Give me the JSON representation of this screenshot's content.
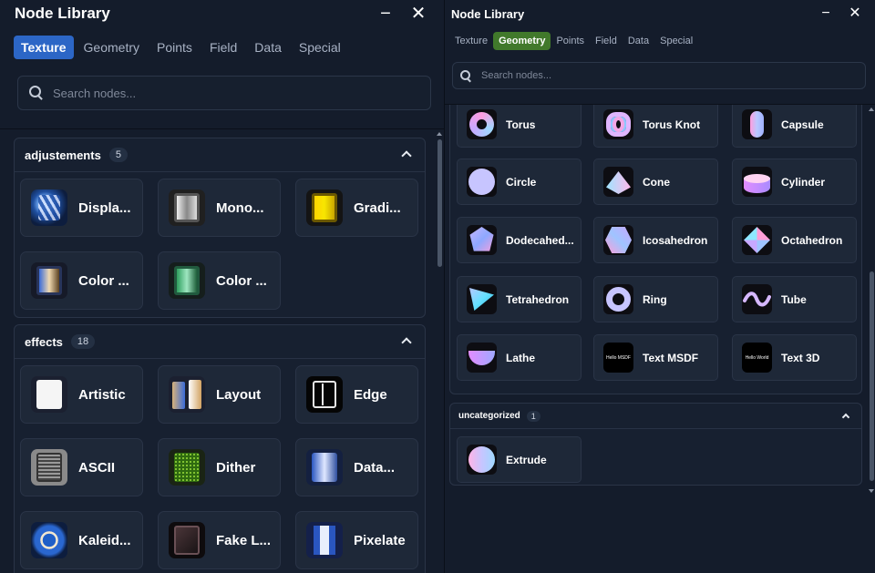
{
  "left": {
    "title": "Node Library",
    "minimize": "−",
    "close": "✕",
    "tabs": [
      "Texture",
      "Geometry",
      "Points",
      "Field",
      "Data",
      "Special"
    ],
    "search_placeholder": "Search nodes...",
    "sections": [
      {
        "title": "adjustements",
        "count": "5",
        "items": [
          {
            "label": "Displa..."
          },
          {
            "label": "Mono..."
          },
          {
            "label": "Gradi..."
          },
          {
            "label": "Color ..."
          },
          {
            "label": "Color ..."
          }
        ]
      },
      {
        "title": "effects",
        "count": "18",
        "items": [
          {
            "label": "Artistic"
          },
          {
            "label": "Layout"
          },
          {
            "label": "Edge"
          },
          {
            "label": "ASCII"
          },
          {
            "label": "Dither"
          },
          {
            "label": "Data..."
          },
          {
            "label": "Kaleid..."
          },
          {
            "label": "Fake L..."
          },
          {
            "label": "Pixelate"
          }
        ]
      }
    ]
  },
  "right": {
    "title": "Node Library",
    "minimize": "−",
    "close": "✕",
    "tabs": [
      "Texture",
      "Geometry",
      "Points",
      "Field",
      "Data",
      "Special"
    ],
    "search_placeholder": "Search nodes...",
    "items": [
      {
        "label": "Torus"
      },
      {
        "label": "Torus Knot"
      },
      {
        "label": "Capsule"
      },
      {
        "label": "Circle"
      },
      {
        "label": "Cone"
      },
      {
        "label": "Cylinder"
      },
      {
        "label": "Dodecahed..."
      },
      {
        "label": "Icosahedron"
      },
      {
        "label": "Octahedron"
      },
      {
        "label": "Tetrahedron"
      },
      {
        "label": "Ring"
      },
      {
        "label": "Tube"
      },
      {
        "label": "Lathe"
      },
      {
        "label": "Text MSDF",
        "thumb_text": "Hello MSDF"
      },
      {
        "label": "Text 3D",
        "thumb_text": "Hello World"
      }
    ],
    "uncategorized": {
      "title": "uncategorized",
      "count": "1",
      "items": [
        {
          "label": "Extrude"
        }
      ]
    }
  },
  "colors": {
    "active_tab_left": "#2c66c6",
    "active_tab_right": "#41792b",
    "panel_bg": "#141c2b",
    "card_bg": "#1e2838"
  }
}
